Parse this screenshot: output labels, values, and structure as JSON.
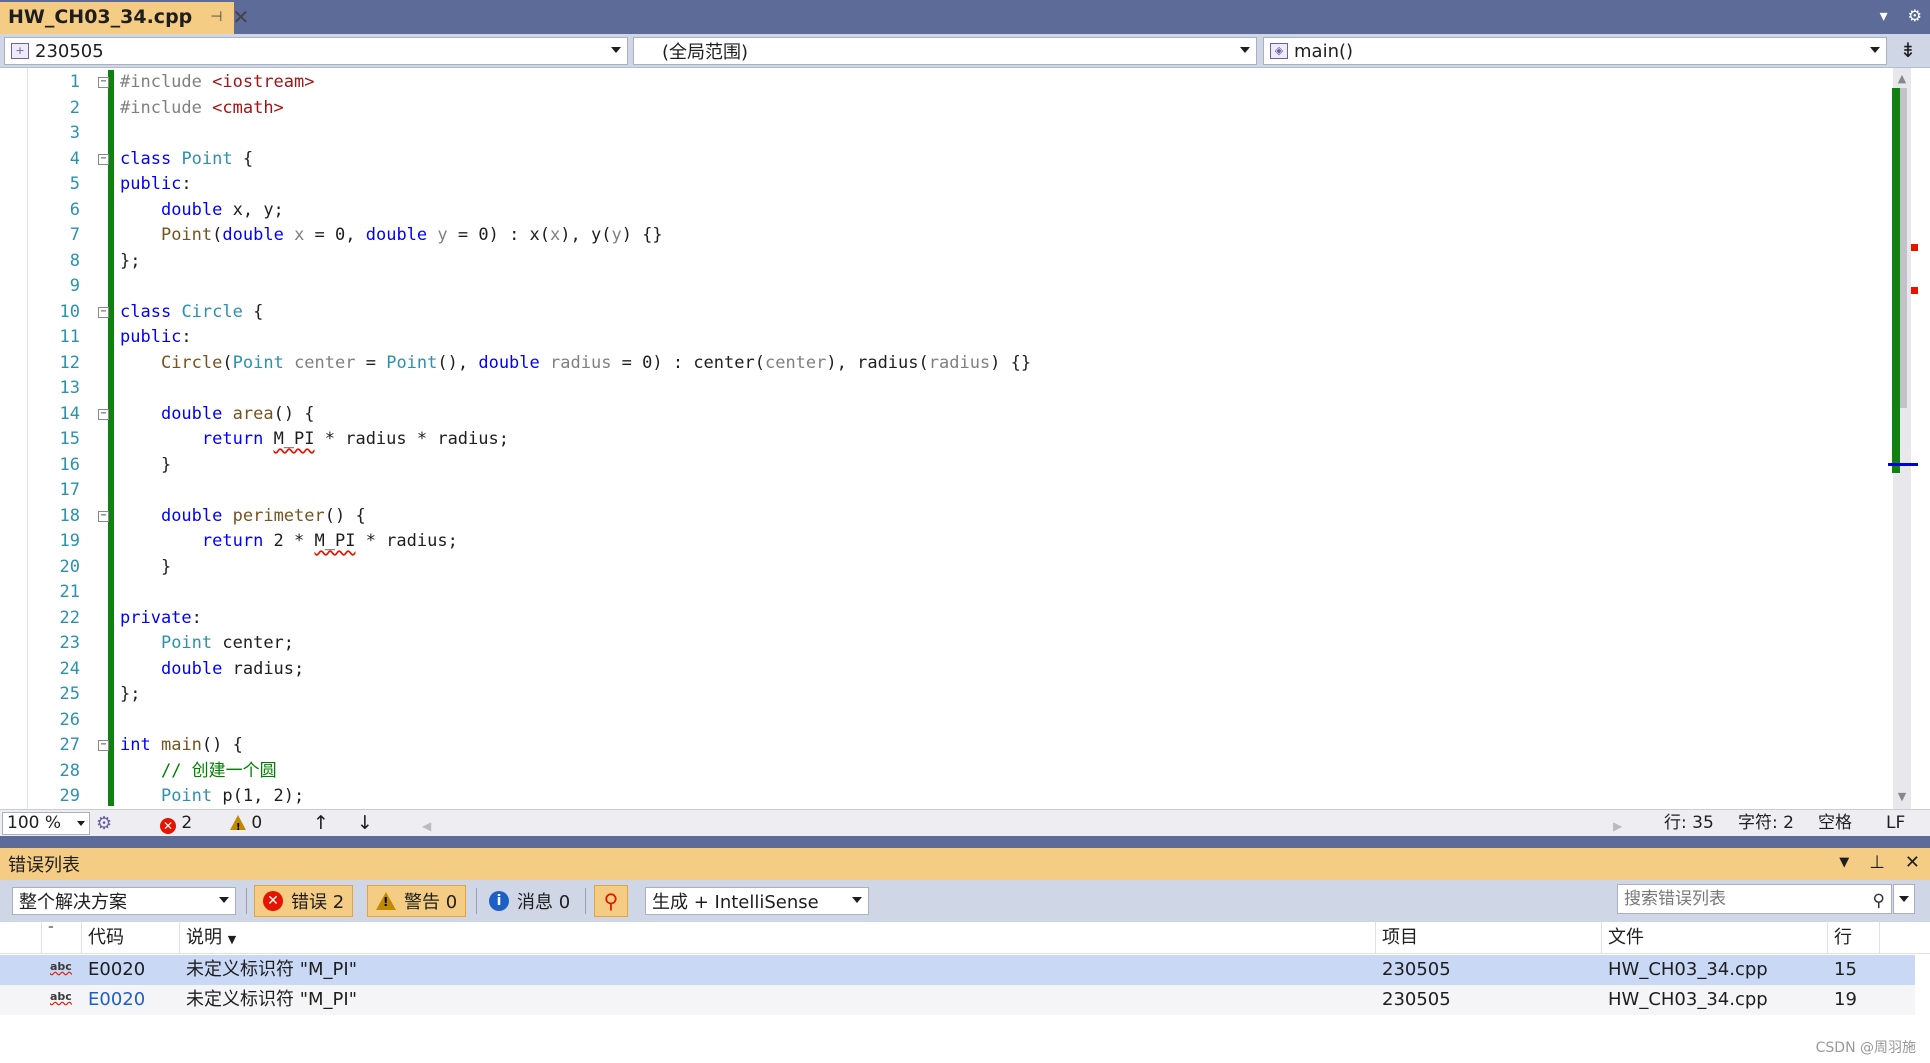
{
  "tab": {
    "filename": "HW_CH03_34.cpp",
    "pin": "⊣",
    "close": "✕"
  },
  "topright": {
    "dropdown": "▾",
    "settings": "⚙"
  },
  "nav": {
    "project": "230505",
    "scope": "(全局范围)",
    "member": "main()",
    "split": "⇟"
  },
  "code_lines": [
    {
      "n": "1",
      "fold": "−",
      "html": "<span class='pp'>#include</span> <span class='st'>&lt;iostream&gt;</span>"
    },
    {
      "n": "2",
      "html": "<span class='pp'>#include</span> <span class='st'>&lt;cmath&gt;</span>"
    },
    {
      "n": "3",
      "html": ""
    },
    {
      "n": "4",
      "fold": "−",
      "html": "<span class='kw'>class</span> <span class='ty'>Point</span> {"
    },
    {
      "n": "5",
      "html": "<span class='kw'>public</span>:"
    },
    {
      "n": "6",
      "html": "    <span class='kw'>double</span> x, y;"
    },
    {
      "n": "7",
      "html": "    <span class='fn'>Point</span>(<span class='kw'>double</span> <span class='pa'>x</span> = 0, <span class='kw'>double</span> <span class='pa'>y</span> = 0) : x(<span class='pa'>x</span>), y(<span class='pa'>y</span>) {}"
    },
    {
      "n": "8",
      "html": "};"
    },
    {
      "n": "9",
      "html": ""
    },
    {
      "n": "10",
      "fold": "−",
      "html": "<span class='kw'>class</span> <span class='ty'>Circle</span> {"
    },
    {
      "n": "11",
      "html": "<span class='kw'>public</span>:"
    },
    {
      "n": "12",
      "html": "    <span class='fn'>Circle</span>(<span class='ty'>Point</span> <span class='pa'>center</span> = <span class='ty'>Point</span>(), <span class='kw'>double</span> <span class='pa'>radius</span> = 0) : center(<span class='pa'>center</span>), radius(<span class='pa'>radius</span>) {}"
    },
    {
      "n": "13",
      "html": ""
    },
    {
      "n": "14",
      "fold": "−",
      "html": "    <span class='kw'>double</span> <span class='fn'>area</span>() {"
    },
    {
      "n": "15",
      "html": "        <span class='kw'>return</span> <span class='sq'>M_PI</span> * radius * radius;"
    },
    {
      "n": "16",
      "html": "    }"
    },
    {
      "n": "17",
      "html": ""
    },
    {
      "n": "18",
      "fold": "−",
      "html": "    <span class='kw'>double</span> <span class='fn'>perimeter</span>() {"
    },
    {
      "n": "19",
      "html": "        <span class='kw'>return</span> 2 * <span class='sq'>M_PI</span> * radius;"
    },
    {
      "n": "20",
      "html": "    }"
    },
    {
      "n": "21",
      "html": ""
    },
    {
      "n": "22",
      "html": "<span class='kw'>private</span>:"
    },
    {
      "n": "23",
      "html": "    <span class='ty'>Point</span> center;"
    },
    {
      "n": "24",
      "html": "    <span class='kw'>double</span> radius;"
    },
    {
      "n": "25",
      "html": "};"
    },
    {
      "n": "26",
      "html": ""
    },
    {
      "n": "27",
      "fold": "−",
      "html": "<span class='kw'>int</span> <span class='fn'>main</span>() {"
    },
    {
      "n": "28",
      "html": "    <span class='cm'>// 创建一个圆</span>"
    },
    {
      "n": "29",
      "html": "    <span class='ty'>Point</span> p(1, 2);"
    }
  ],
  "editor_status": {
    "zoom": "100 %",
    "errors": "2",
    "warnings": "0",
    "up": "↑",
    "down": "↓",
    "line": "行: 35",
    "char": "字符: 2",
    "space": "空格",
    "eol": "LF"
  },
  "error_list": {
    "title": "错误列表",
    "scope": "整个解决方案",
    "errors_btn": "错误 2",
    "warnings_btn": "警告 0",
    "messages_btn": "消息 0",
    "build_filter": "生成 + IntelliSense",
    "search_placeholder": "搜索错误列表",
    "columns": {
      "code": "代码",
      "desc": "说明",
      "project": "项目",
      "file": "文件",
      "line": "行"
    },
    "rows": [
      {
        "code": "E0020",
        "desc": "未定义标识符 \"M_PI\"",
        "project": "230505",
        "file": "HW_CH03_34.cpp",
        "line": "15"
      },
      {
        "code": "E0020",
        "desc": "未定义标识符 \"M_PI\"",
        "project": "230505",
        "file": "HW_CH03_34.cpp",
        "line": "19"
      }
    ]
  },
  "watermark": "CSDN @周羽施",
  "colors": {
    "accent": "#f5cc84",
    "chrome": "#5d6b99",
    "error": "#e51400",
    "change_bar": "#108010"
  }
}
